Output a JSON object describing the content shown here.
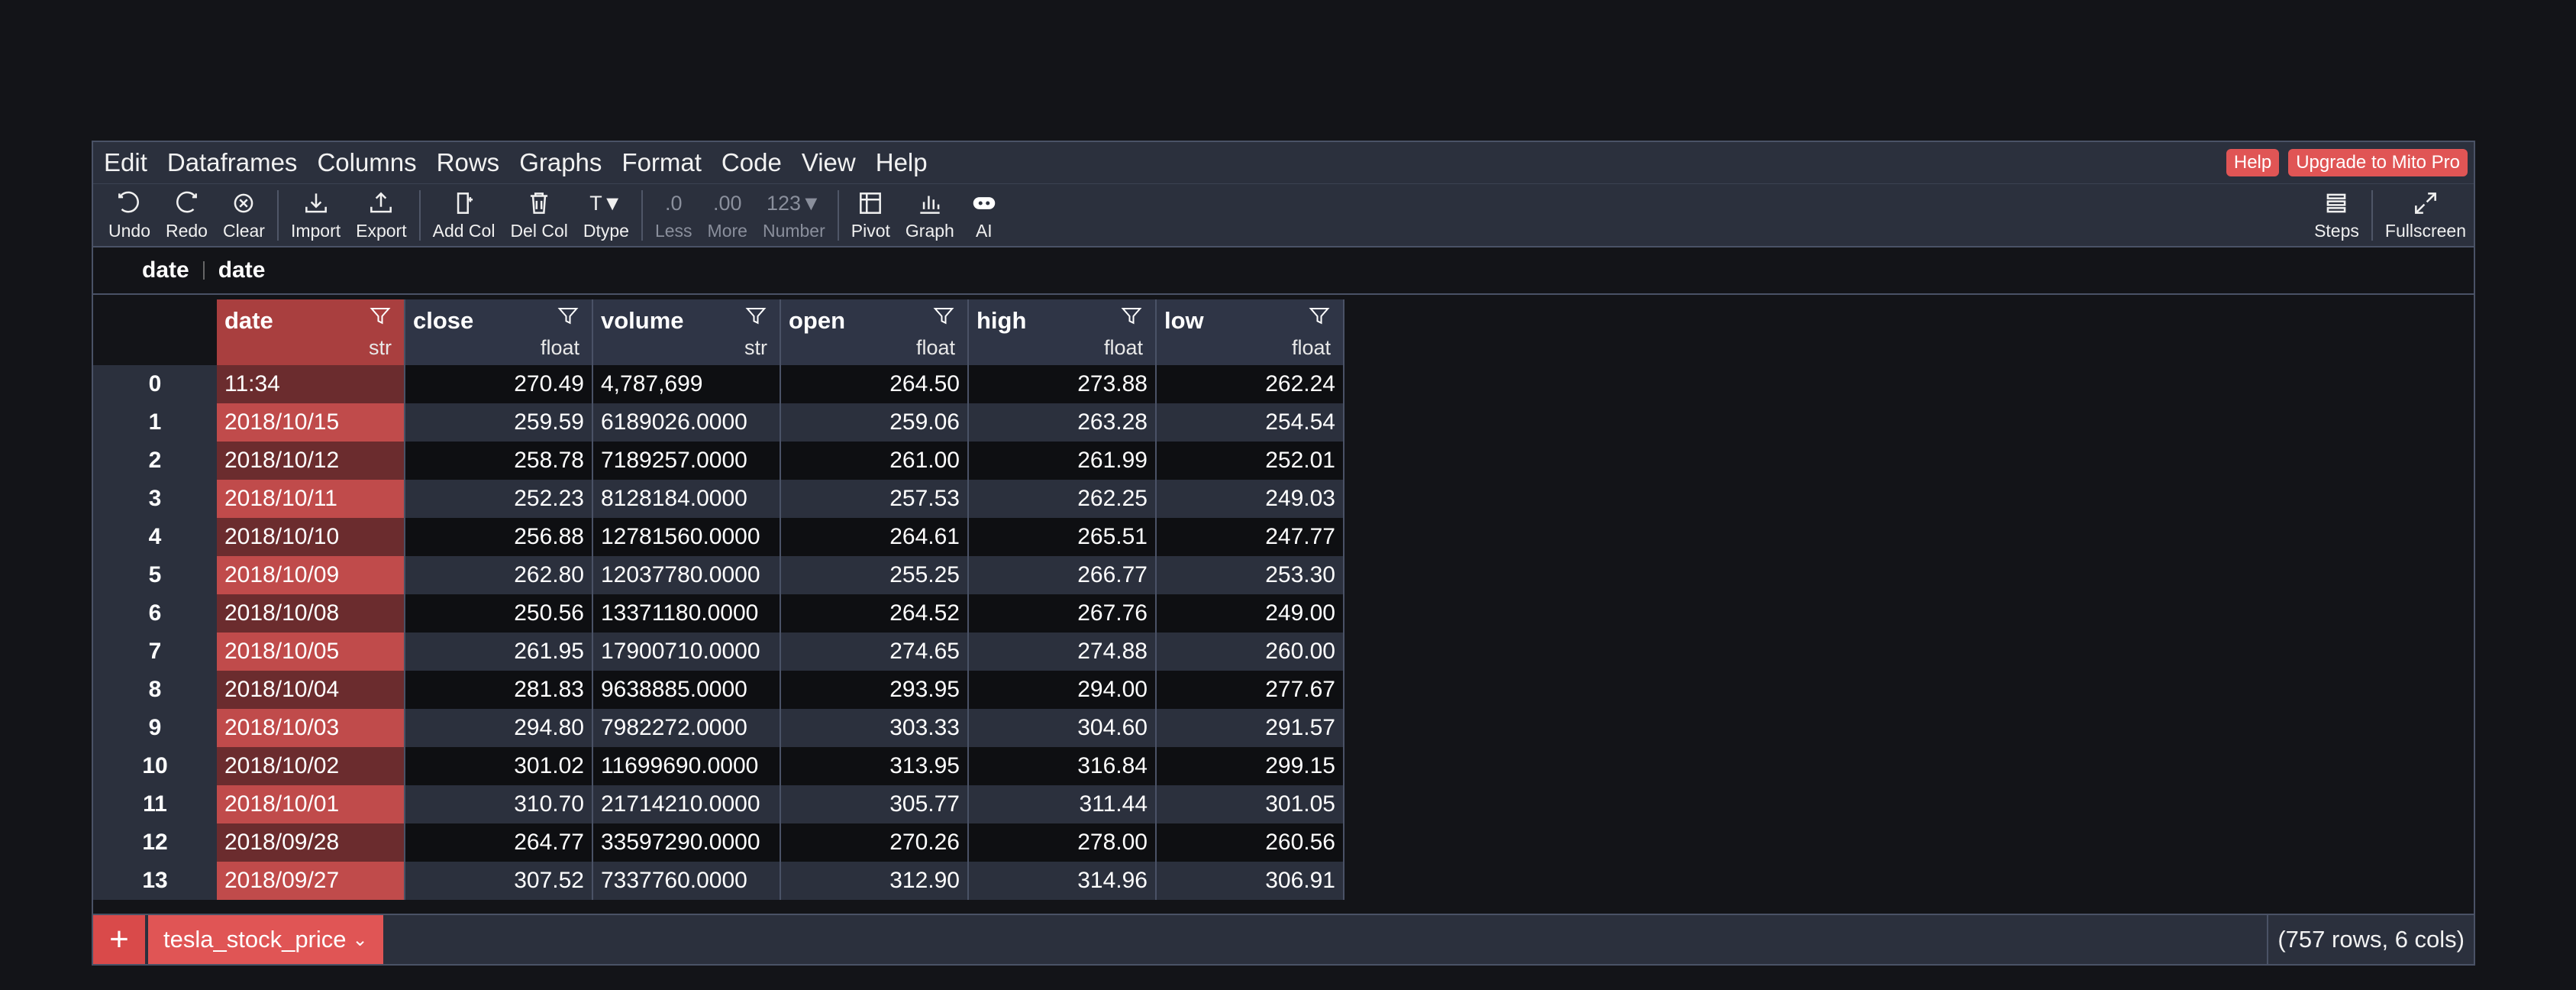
{
  "menu": [
    "Edit",
    "Dataframes",
    "Columns",
    "Rows",
    "Graphs",
    "Format",
    "Code",
    "View",
    "Help"
  ],
  "menu_right": {
    "help": "Help",
    "upgrade": "Upgrade to Mito Pro"
  },
  "toolbar": {
    "undo": "Undo",
    "redo": "Redo",
    "clear": "Clear",
    "import": "Import",
    "export": "Export",
    "add_col": "Add Col",
    "del_col": "Del Col",
    "dtype": "Dtype",
    "dtype_glyph": "T▼",
    "less": "Less",
    "less_glyph": ".0",
    "more": "More",
    "more_glyph": ".00",
    "number": "Number",
    "number_glyph": "123▼",
    "pivot": "Pivot",
    "graph": "Graph",
    "ai": "AI",
    "steps": "Steps",
    "fullscreen": "Fullscreen"
  },
  "formula_bar": {
    "column": "date",
    "value": "date"
  },
  "columns": [
    {
      "name": "date",
      "dtype": "str"
    },
    {
      "name": "close",
      "dtype": "float"
    },
    {
      "name": "volume",
      "dtype": "str"
    },
    {
      "name": "open",
      "dtype": "float"
    },
    {
      "name": "high",
      "dtype": "float"
    },
    {
      "name": "low",
      "dtype": "float"
    }
  ],
  "rows": [
    {
      "idx": "0",
      "date": "11:34",
      "close": "270.49",
      "volume": "4,787,699",
      "open": "264.50",
      "high": "273.88",
      "low": "262.24"
    },
    {
      "idx": "1",
      "date": "2018/10/15",
      "close": "259.59",
      "volume": "6189026.0000",
      "open": "259.06",
      "high": "263.28",
      "low": "254.54"
    },
    {
      "idx": "2",
      "date": "2018/10/12",
      "close": "258.78",
      "volume": "7189257.0000",
      "open": "261.00",
      "high": "261.99",
      "low": "252.01"
    },
    {
      "idx": "3",
      "date": "2018/10/11",
      "close": "252.23",
      "volume": "8128184.0000",
      "open": "257.53",
      "high": "262.25",
      "low": "249.03"
    },
    {
      "idx": "4",
      "date": "2018/10/10",
      "close": "256.88",
      "volume": "12781560.0000",
      "open": "264.61",
      "high": "265.51",
      "low": "247.77"
    },
    {
      "idx": "5",
      "date": "2018/10/09",
      "close": "262.80",
      "volume": "12037780.0000",
      "open": "255.25",
      "high": "266.77",
      "low": "253.30"
    },
    {
      "idx": "6",
      "date": "2018/10/08",
      "close": "250.56",
      "volume": "13371180.0000",
      "open": "264.52",
      "high": "267.76",
      "low": "249.00"
    },
    {
      "idx": "7",
      "date": "2018/10/05",
      "close": "261.95",
      "volume": "17900710.0000",
      "open": "274.65",
      "high": "274.88",
      "low": "260.00"
    },
    {
      "idx": "8",
      "date": "2018/10/04",
      "close": "281.83",
      "volume": "9638885.0000",
      "open": "293.95",
      "high": "294.00",
      "low": "277.67"
    },
    {
      "idx": "9",
      "date": "2018/10/03",
      "close": "294.80",
      "volume": "7982272.0000",
      "open": "303.33",
      "high": "304.60",
      "low": "291.57"
    },
    {
      "idx": "10",
      "date": "2018/10/02",
      "close": "301.02",
      "volume": "11699690.0000",
      "open": "313.95",
      "high": "316.84",
      "low": "299.15"
    },
    {
      "idx": "11",
      "date": "2018/10/01",
      "close": "310.70",
      "volume": "21714210.0000",
      "open": "305.77",
      "high": "311.44",
      "low": "301.05"
    },
    {
      "idx": "12",
      "date": "2018/09/28",
      "close": "264.77",
      "volume": "33597290.0000",
      "open": "270.26",
      "high": "278.00",
      "low": "260.56"
    },
    {
      "idx": "13",
      "date": "2018/09/27",
      "close": "307.52",
      "volume": "7337760.0000",
      "open": "312.90",
      "high": "314.96",
      "low": "306.91"
    }
  ],
  "sheet_tab": "tesla_stock_price",
  "row_count": "(757 rows, 6 cols)",
  "colors": {
    "accent": "#e05555",
    "selected_column": "#c04b4b",
    "background": "#131418",
    "panel": "#2b303d"
  },
  "icons": [
    "undo-icon",
    "redo-icon",
    "clear-icon",
    "import-icon",
    "export-icon",
    "add-col-icon",
    "del-col-icon",
    "pivot-icon",
    "graph-icon",
    "ai-icon",
    "steps-icon",
    "fullscreen-icon",
    "filter-icon",
    "plus-icon",
    "chevron-down-icon"
  ]
}
